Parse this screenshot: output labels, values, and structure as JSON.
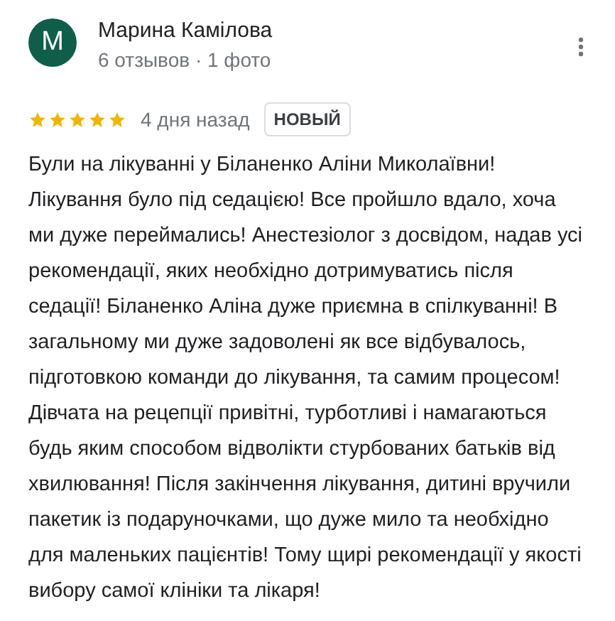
{
  "author": {
    "initial": "M",
    "name": "Марина Камілова",
    "meta": "6 отзывов · 1 фото"
  },
  "review": {
    "stars": 5,
    "time": "4 дня назад",
    "badge": "НОВЫЙ",
    "text": "Були на лікуванні у Біланенко Аліни Миколаївни! Лікування було під седацією! Все пройшло вдало, хоча ми дуже переймались! Анестезіолог з досвідом, надав усі рекомендації, яких необхідно дотримуватись після седації! Біланенко Аліна дуже приємна в спілкуванні! В загальному ми дуже задоволені як все відбувалось, підготовкою команди до лікування, та самим процесом! Дівчата на рецепції привітні, турботливі і намагаються будь яким способом відволікти стурбованих батьків від хвилювання! Після закінчення лікування, дитині вручили пакетик із подаруночками, що дуже мило та необхідно для маленьких пацієнтів! Тому щирі рекомендації у якості вибору самої клініки та лікаря!"
  }
}
